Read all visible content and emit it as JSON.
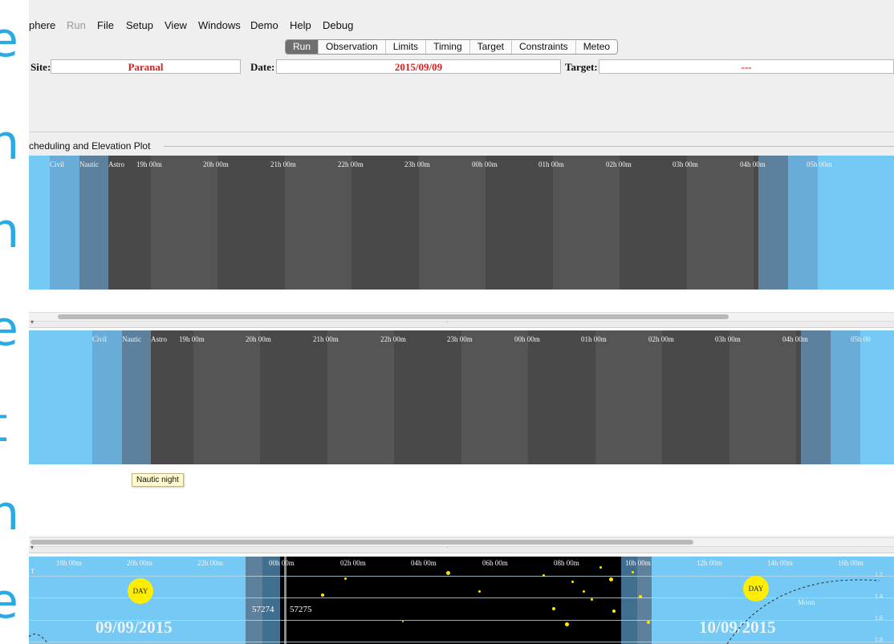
{
  "menu": [
    "phere",
    "Run",
    "File",
    "Setup",
    "View",
    "Windows",
    "Demo",
    "Help",
    "Debug"
  ],
  "tabs": [
    "Run",
    "Observation",
    "Limits",
    "Timing",
    "Target",
    "Constraints",
    "Meteo"
  ],
  "active_tab": "Run",
  "site": {
    "label": "Site:",
    "value": "Paranal"
  },
  "date": {
    "label": "Date:",
    "value": "2015/09/09"
  },
  "target": {
    "label": "Target:",
    "value": "---"
  },
  "section_title": "cheduling and Elevation Plot",
  "twilight_labels": {
    "civil": "Civil",
    "nautic": "Nautic",
    "astro": "Astro"
  },
  "plot1_ticks": [
    "19h 00m",
    "20h 00m",
    "21h 00m",
    "22h 00m",
    "23h 00m",
    "00h 00m",
    "01h 00m",
    "02h 00m",
    "03h 00m",
    "04h 00m",
    "05h 00m"
  ],
  "plot2_ticks": [
    "19h 00m",
    "20h 00m",
    "21h 00m",
    "22h 00m",
    "23h 00m",
    "00h 00m",
    "01h 00m",
    "02h 00m",
    "03h 00m",
    "04h 00m",
    "05h 00"
  ],
  "tooltip": "Nautic night",
  "plot3": {
    "ticks": [
      "18h 00m",
      "20h 00m",
      "22h 00m",
      "00h 00m",
      "02h 00m",
      "04h 00m",
      "06h 00m",
      "08h 00m",
      "10h 00m",
      "12h 00m",
      "14h 00m",
      "16h 00m"
    ],
    "airmass": [
      "1.2",
      "1.4",
      "1.6",
      "1.8"
    ],
    "day_label": "DAY",
    "date_left": "09/09/2015",
    "date_right": "10/09/2015",
    "mjd_left": "57274",
    "mjd_right": "57275",
    "moon_label": "Moon",
    "t_label": "T"
  },
  "colors": {
    "day": "#74c9f5",
    "civil": "#6aacd8",
    "nautic": "#5d819d",
    "night": "#4a4a4a",
    "accent_text": "#e02020"
  }
}
